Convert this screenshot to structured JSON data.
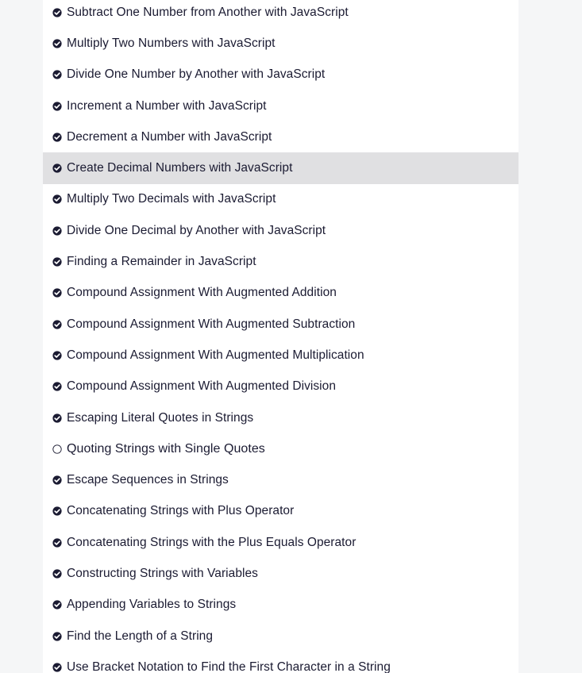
{
  "colors": {
    "page_background": "#f5f6f7",
    "panel_background": "#ffffff",
    "highlight_background": "#e0e0e2",
    "text": "#1b1b32",
    "check_icon": "#1b1b32"
  },
  "challenges": [
    {
      "label": "Subtract One Number from Another with JavaScript",
      "status": "completed",
      "icon": "check-circle-icon"
    },
    {
      "label": "Multiply Two Numbers with JavaScript",
      "status": "completed",
      "icon": "check-circle-icon"
    },
    {
      "label": "Divide One Number by Another with JavaScript",
      "status": "completed",
      "icon": "check-circle-icon"
    },
    {
      "label": "Increment a Number with JavaScript",
      "status": "completed",
      "icon": "check-circle-icon"
    },
    {
      "label": "Decrement a Number with JavaScript",
      "status": "completed",
      "icon": "check-circle-icon"
    },
    {
      "label": "Create Decimal Numbers with JavaScript",
      "status": "completed",
      "icon": "check-circle-icon",
      "highlighted": true
    },
    {
      "label": "Multiply Two Decimals with JavaScript",
      "status": "completed",
      "icon": "check-circle-icon"
    },
    {
      "label": "Divide One Decimal by Another with JavaScript",
      "status": "completed",
      "icon": "check-circle-icon"
    },
    {
      "label": "Finding a Remainder in JavaScript",
      "status": "completed",
      "icon": "check-circle-icon"
    },
    {
      "label": "Compound Assignment With Augmented Addition",
      "status": "completed",
      "icon": "check-circle-icon"
    },
    {
      "label": "Compound Assignment With Augmented Subtraction",
      "status": "completed",
      "icon": "check-circle-icon"
    },
    {
      "label": "Compound Assignment With Augmented Multiplication",
      "status": "completed",
      "icon": "check-circle-icon"
    },
    {
      "label": "Compound Assignment With Augmented Division",
      "status": "completed",
      "icon": "check-circle-icon"
    },
    {
      "label": "Escaping Literal Quotes in Strings",
      "status": "completed",
      "icon": "check-circle-icon"
    },
    {
      "label": "Quoting Strings with Single Quotes",
      "status": "incomplete",
      "icon": "empty-circle-icon"
    },
    {
      "label": "Escape Sequences in Strings",
      "status": "completed",
      "icon": "check-circle-icon"
    },
    {
      "label": "Concatenating Strings with Plus Operator",
      "status": "completed",
      "icon": "check-circle-icon"
    },
    {
      "label": "Concatenating Strings with the Plus Equals Operator",
      "status": "completed",
      "icon": "check-circle-icon"
    },
    {
      "label": "Constructing Strings with Variables",
      "status": "completed",
      "icon": "check-circle-icon"
    },
    {
      "label": "Appending Variables to Strings",
      "status": "completed",
      "icon": "check-circle-icon"
    },
    {
      "label": "Find the Length of a String",
      "status": "completed",
      "icon": "check-circle-icon"
    },
    {
      "label": "Use Bracket Notation to Find the First Character in a String",
      "status": "completed",
      "icon": "check-circle-icon"
    }
  ]
}
